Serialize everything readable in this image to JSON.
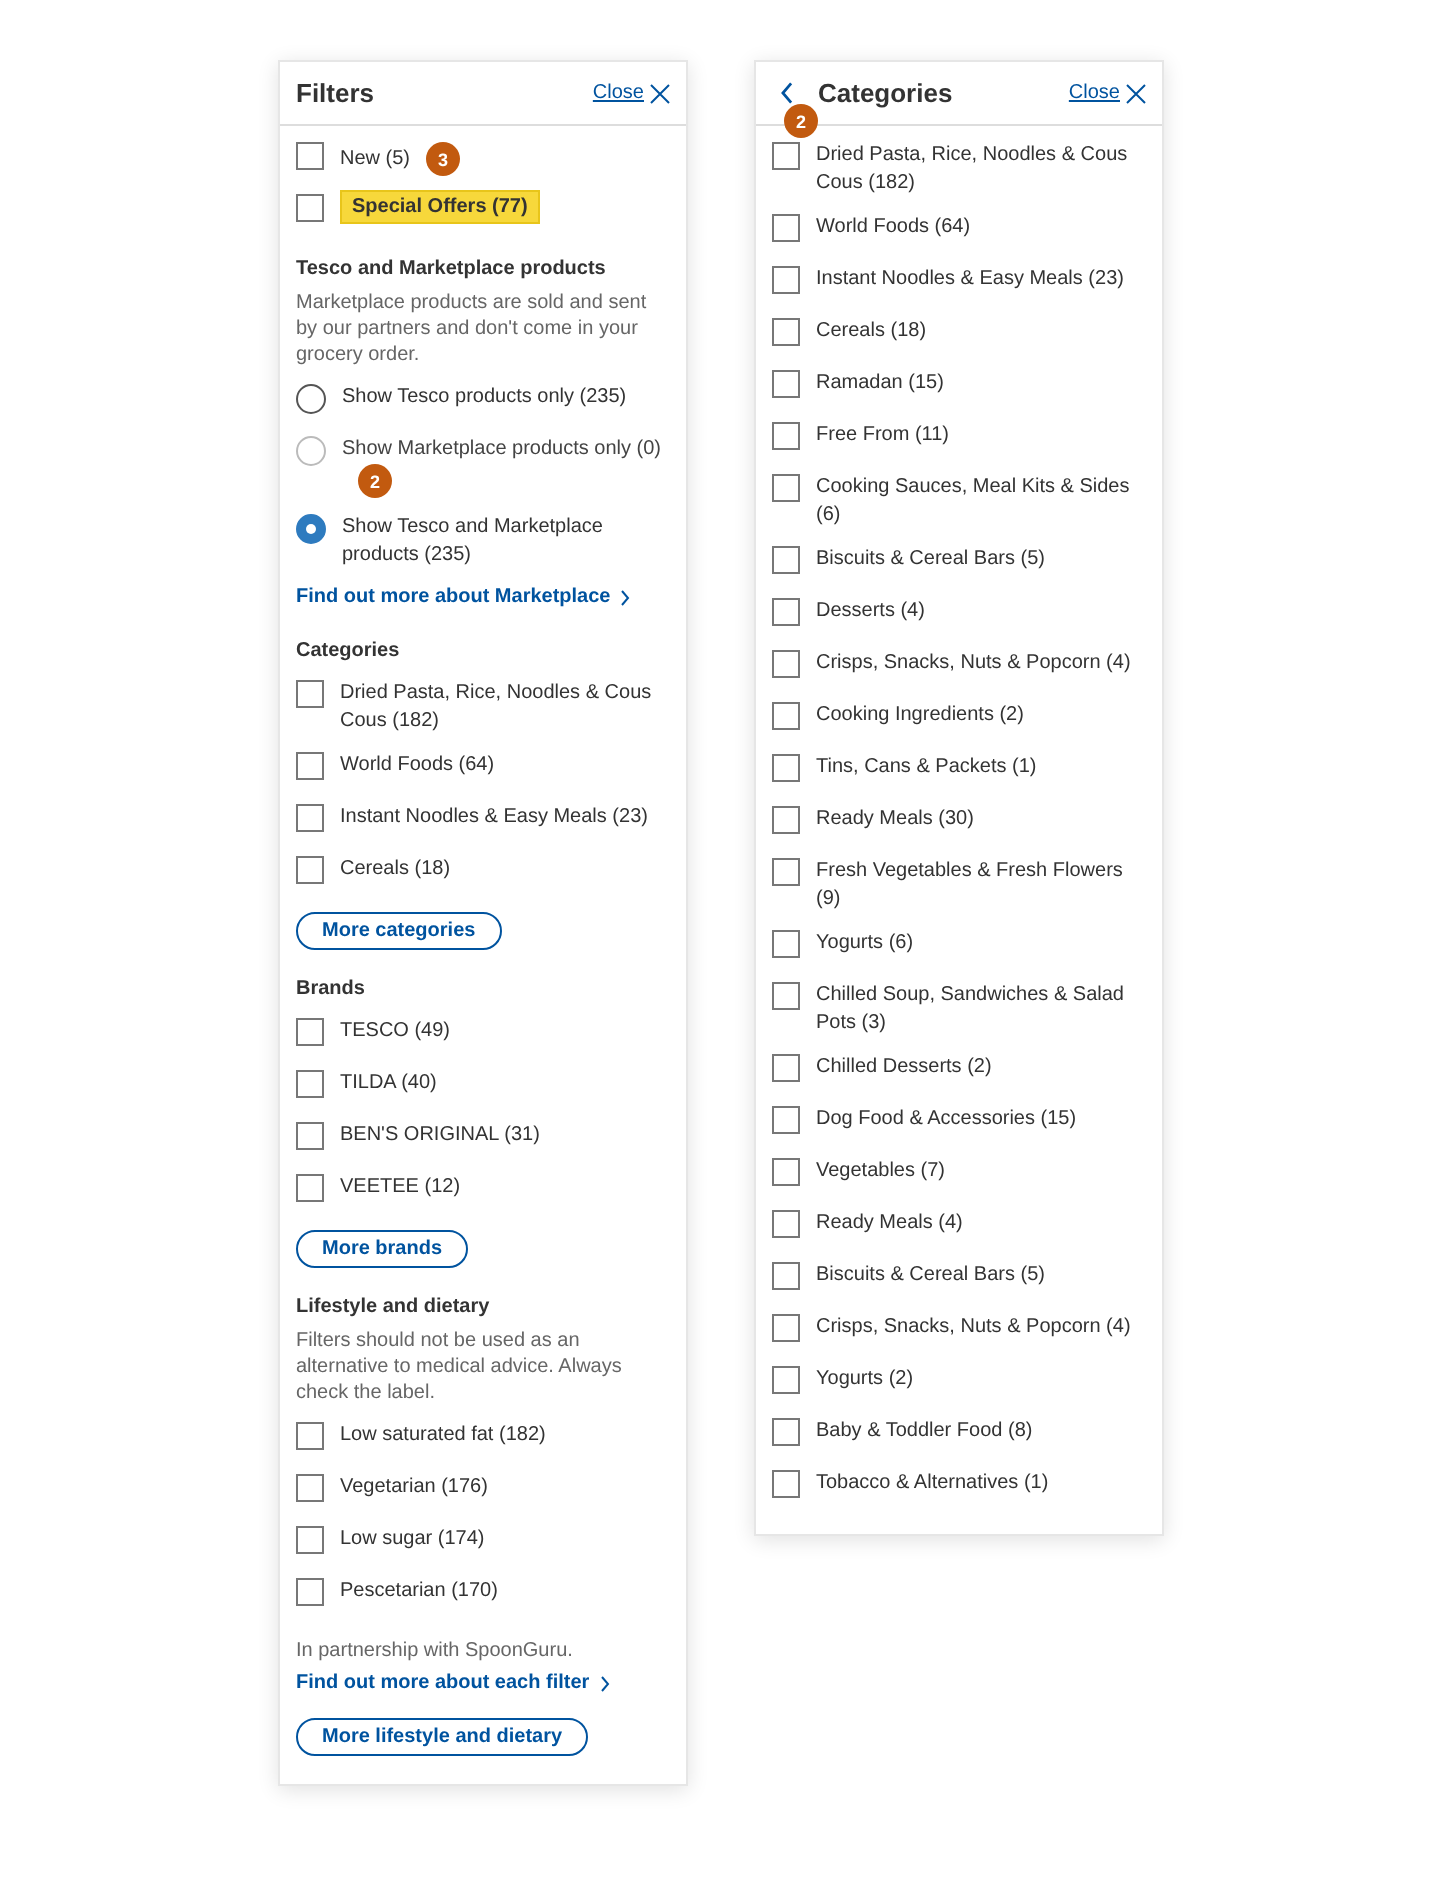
{
  "filters_panel": {
    "title": "Filters",
    "close": "Close",
    "blocks": [
      {
        "kind": "checkbox",
        "label": "New (5)",
        "checked": false,
        "highlighted": false,
        "badge": "3"
      },
      {
        "kind": "checkbox",
        "label": "Special Offers (77)",
        "checked": false,
        "highlighted": true
      },
      {
        "kind": "heading",
        "text": "Tesco and Marketplace products"
      },
      {
        "kind": "note",
        "text": "Marketplace products are sold and sent by our partners and don't come in your grocery order."
      },
      {
        "kind": "radio",
        "label": "Show Tesco products only (235)",
        "selected": false,
        "disabled": false
      },
      {
        "kind": "radio",
        "label": "Show Marketplace products only (0)",
        "selected": false,
        "disabled": true,
        "badge": "2"
      },
      {
        "kind": "radio",
        "label": "Show Tesco and Marketplace products (235)",
        "selected": true,
        "disabled": false
      },
      {
        "kind": "link",
        "text": "Find out more about Marketplace"
      },
      {
        "kind": "heading",
        "text": "Categories"
      },
      {
        "kind": "checkbox",
        "label": "Dried Pasta, Rice, Noodles & Cous Cous (182)",
        "checked": false
      },
      {
        "kind": "checkbox",
        "label": "World Foods (64)",
        "checked": false
      },
      {
        "kind": "checkbox",
        "label": "Instant Noodles & Easy Meals (23)",
        "checked": false
      },
      {
        "kind": "checkbox",
        "label": "Cereals (18)",
        "checked": false
      },
      {
        "kind": "button",
        "text": "More categories"
      },
      {
        "kind": "heading",
        "text": "Brands"
      },
      {
        "kind": "checkbox",
        "label": "TESCO (49)",
        "checked": false
      },
      {
        "kind": "checkbox",
        "label": "TILDA (40)",
        "checked": false
      },
      {
        "kind": "checkbox",
        "label": "BEN'S ORIGINAL (31)",
        "checked": false
      },
      {
        "kind": "checkbox",
        "label": "VEETEE (12)",
        "checked": false
      },
      {
        "kind": "button",
        "text": "More brands"
      },
      {
        "kind": "heading",
        "text": "Lifestyle and dietary"
      },
      {
        "kind": "note",
        "text": "Filters should not be used as an alternative to medical advice. Always check the label."
      },
      {
        "kind": "checkbox",
        "label": "Low saturated fat (182)",
        "checked": false
      },
      {
        "kind": "checkbox",
        "label": "Vegetarian (176)",
        "checked": false
      },
      {
        "kind": "checkbox",
        "label": "Low sugar (174)",
        "checked": false
      },
      {
        "kind": "checkbox",
        "label": "Pescetarian (170)",
        "checked": false
      },
      {
        "kind": "plain",
        "text": "In partnership with SpoonGuru."
      },
      {
        "kind": "link",
        "text": "Find out more about each filter"
      },
      {
        "kind": "button",
        "text": "More lifestyle and dietary"
      }
    ]
  },
  "categories_panel": {
    "title": "Categories",
    "close": "Close",
    "badge": "2",
    "items": [
      {
        "label": "Dried Pasta, Rice, Noodles & Cous Cous (182)",
        "checked": false
      },
      {
        "label": "World Foods (64)",
        "checked": false
      },
      {
        "label": "Instant Noodles & Easy Meals (23)",
        "checked": false
      },
      {
        "label": "Cereals (18)",
        "checked": false
      },
      {
        "label": "Ramadan (15)",
        "checked": false
      },
      {
        "label": "Free From (11)",
        "checked": false
      },
      {
        "label": "Cooking Sauces, Meal Kits & Sides (6)",
        "checked": false
      },
      {
        "label": "Biscuits & Cereal Bars (5)",
        "checked": false
      },
      {
        "label": "Desserts (4)",
        "checked": false
      },
      {
        "label": "Crisps, Snacks, Nuts & Popcorn (4)",
        "checked": false
      },
      {
        "label": "Cooking Ingredients (2)",
        "checked": false
      },
      {
        "label": "Tins, Cans & Packets (1)",
        "checked": false
      },
      {
        "label": "Ready Meals (30)",
        "checked": false
      },
      {
        "label": "Fresh Vegetables & Fresh Flowers (9)",
        "checked": false
      },
      {
        "label": "Yogurts (6)",
        "checked": false
      },
      {
        "label": "Chilled Soup, Sandwiches & Salad Pots (3)",
        "checked": false
      },
      {
        "label": "Chilled Desserts (2)",
        "checked": false
      },
      {
        "label": "Dog Food & Accessories (15)",
        "checked": false
      },
      {
        "label": "Vegetables (7)",
        "checked": false
      },
      {
        "label": "Ready Meals (4)",
        "checked": false
      },
      {
        "label": "Biscuits & Cereal Bars (5)",
        "checked": false
      },
      {
        "label": "Crisps, Snacks, Nuts & Popcorn (4)",
        "checked": false
      },
      {
        "label": "Yogurts (2)",
        "checked": false
      },
      {
        "label": "Baby & Toddler Food (8)",
        "checked": false
      },
      {
        "label": "Tobacco & Alternatives (1)",
        "checked": false
      }
    ]
  }
}
